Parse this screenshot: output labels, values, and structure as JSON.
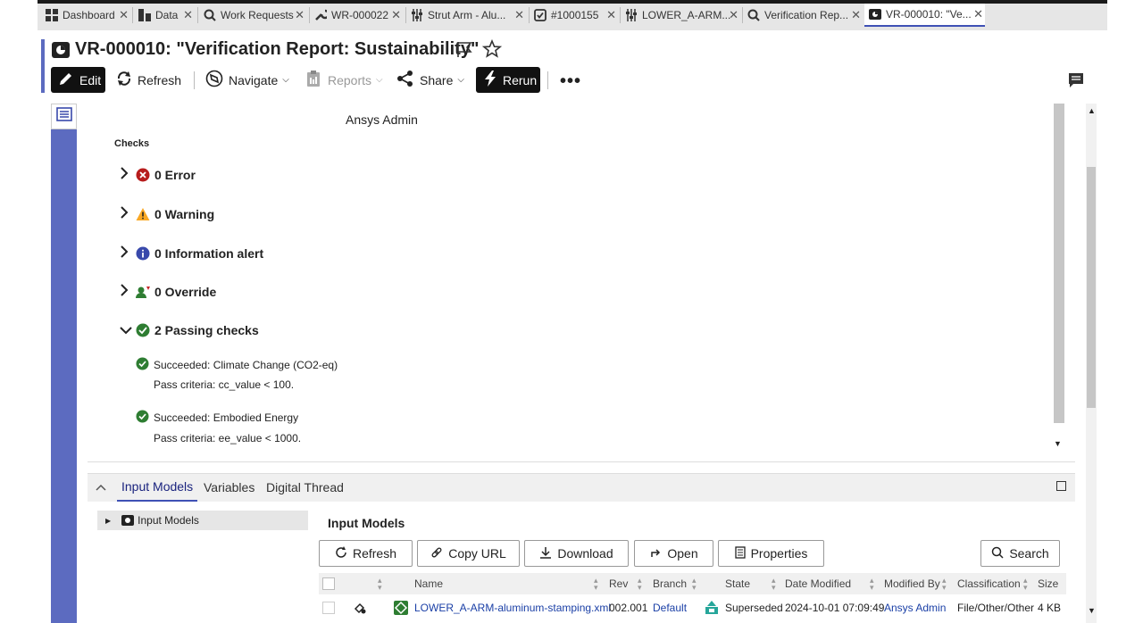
{
  "tabs": [
    {
      "label": "Dashboard",
      "icon": "dashboard-icon"
    },
    {
      "label": "Data",
      "icon": "data-icon"
    },
    {
      "label": "Work Requests",
      "icon": "search-icon"
    },
    {
      "label": "WR-000022",
      "icon": "wrench-icon"
    },
    {
      "label": "Strut Arm - Alu...",
      "icon": "sliders-icon"
    },
    {
      "label": "#1000155",
      "icon": "task-icon"
    },
    {
      "label": "LOWER_A-ARM...",
      "icon": "sliders-icon"
    },
    {
      "label": "Verification Rep...",
      "icon": "search-icon"
    },
    {
      "label": "VR-000010: \"Ve...",
      "icon": "report-icon",
      "active": true
    }
  ],
  "header": {
    "title": "VR-000010: \"Verification Report: Sustainability\""
  },
  "toolbar": {
    "edit": "Edit",
    "refresh": "Refresh",
    "navigate": "Navigate",
    "reports": "Reports",
    "share": "Share",
    "rerun": "Rerun"
  },
  "content": {
    "author": "Ansys Admin",
    "checks_heading": "Checks",
    "groups": [
      {
        "label": "0 Error",
        "icon": "error-icon",
        "expanded": false
      },
      {
        "label": "0 Warning",
        "icon": "warning-icon",
        "expanded": false
      },
      {
        "label": "0 Information alert",
        "icon": "info-icon",
        "expanded": false
      },
      {
        "label": "0 Override",
        "icon": "override-icon",
        "expanded": false
      },
      {
        "label": "2 Passing checks",
        "icon": "pass-icon",
        "expanded": true
      }
    ],
    "passing": [
      {
        "title": "Succeeded: Climate Change (CO2-eq)",
        "criteria": "Pass criteria: cc_value < 100."
      },
      {
        "title": "Succeeded: Embodied Energy",
        "criteria": "Pass criteria: ee_value < 1000."
      }
    ]
  },
  "bottom": {
    "tabs": [
      "Input Models",
      "Variables",
      "Digital Thread"
    ],
    "tree_item": "Input Models",
    "section_title": "Input Models",
    "buttons": {
      "refresh": "Refresh",
      "copy_url": "Copy URL",
      "download": "Download",
      "open": "Open",
      "properties": "Properties",
      "search": "Search"
    },
    "columns": [
      "Name",
      "Rev",
      "Branch",
      "State",
      "Date Modified",
      "Modified By",
      "Classification",
      "Size"
    ],
    "rows": [
      {
        "name": "LOWER_A-ARM-aluminum-stamping.xml",
        "rev": "002.001",
        "branch": "Default",
        "state": "Superseded",
        "date": "2024-10-01 07:09:49",
        "modified_by": "Ansys Admin",
        "classification": "File/Other/Other",
        "size": "4 KB"
      }
    ]
  },
  "colors": {
    "accent": "#5c6bc0",
    "error": "#b71c1c",
    "warning": "#f9a825",
    "info": "#3949ab",
    "pass": "#2e7d32"
  }
}
